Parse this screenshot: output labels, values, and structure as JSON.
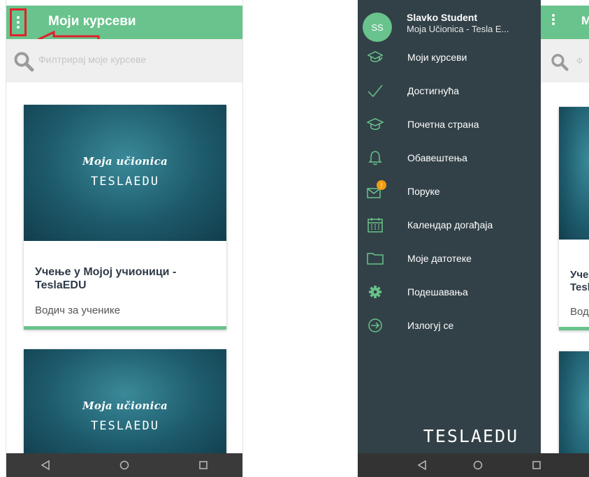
{
  "left": {
    "app_bar": {
      "title": "Моји курсеви"
    },
    "search": {
      "placeholder": "Филтрирај моје курсеве"
    },
    "cards": [
      {
        "brand_script": "Moja učionica",
        "brand_logo": "TESLAEDU",
        "title": "Учење у Мојој учионици - TeslaEDU",
        "subtitle": "Водич за ученике"
      },
      {
        "brand_script": "Moja učionica",
        "brand_logo": "TESLAEDU"
      }
    ]
  },
  "right": {
    "header": {
      "avatar_initials": "SS",
      "user_name": "Slavko Student",
      "user_org": "Moja Učionica - Tesla E..."
    },
    "menu": [
      {
        "label": "Моји курсеви",
        "icon": "courses-icon"
      },
      {
        "label": "Достигнућа",
        "icon": "check-icon"
      },
      {
        "label": "Почетна страна",
        "icon": "graduation-cap-icon"
      },
      {
        "label": "Обавештења",
        "icon": "bell-icon"
      },
      {
        "label": "Поруке",
        "icon": "mail-icon",
        "badge": "!"
      },
      {
        "label": "Календар догађаја",
        "icon": "calendar-icon"
      },
      {
        "label": "Моје датотеке",
        "icon": "folder-icon"
      },
      {
        "label": "Подешавања",
        "icon": "gear-icon"
      },
      {
        "label": "Излогуј се",
        "icon": "logout-icon"
      }
    ],
    "footer_logo": "TESLAEDU",
    "background_fragments": {
      "title": "М",
      "search": "Ф",
      "card_title_1": "Уче",
      "card_title_2": "Tesl",
      "card_sub": "Вод"
    }
  },
  "colors": {
    "accent_green": "#69c38c",
    "drawer_bg": "#324147",
    "highlight_red": "#e0222a",
    "badge_orange": "#f39c12"
  }
}
